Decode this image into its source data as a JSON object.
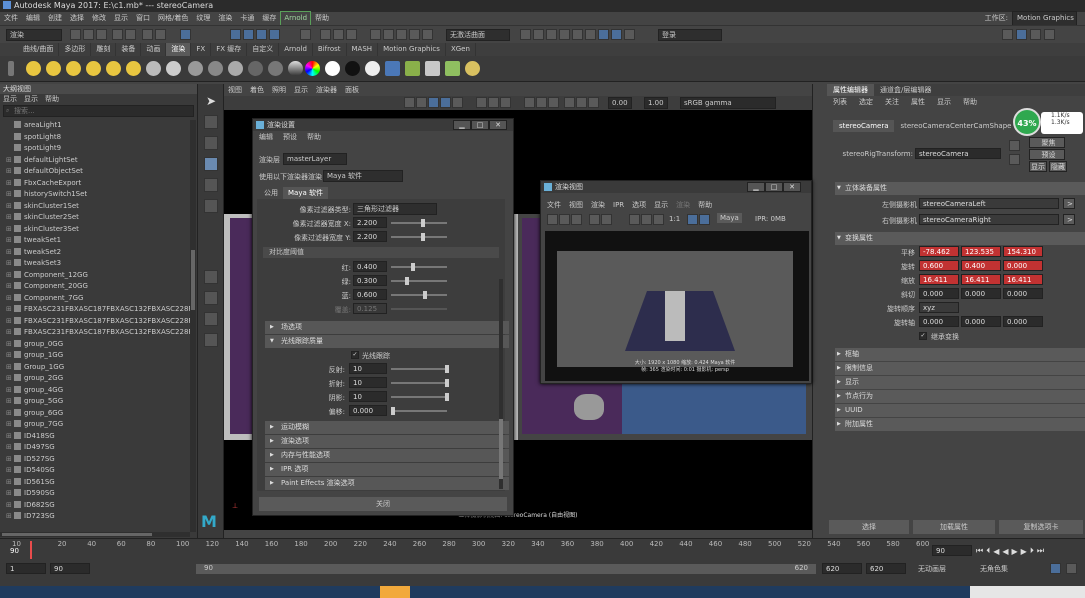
{
  "title": "Autodesk Maya 2017: E:\\c1.mb*   ---   stereoCamera",
  "menubar": {
    "items": [
      "文件",
      "编辑",
      "创建",
      "选择",
      "修改",
      "显示",
      "窗口",
      "网格/着色",
      "纹理",
      "渲染",
      "卡通",
      "缓存"
    ],
    "arnold": "Arnold",
    "help": "帮助",
    "workspace_label": "工作区:",
    "workspace_value": "Motion Graphics"
  },
  "statusline": {
    "mode": "渲染",
    "render_field": "无激活曲面",
    "login": "登录"
  },
  "shelf_tabs": [
    "曲线/曲面",
    "多边形",
    "雕刻",
    "装备",
    "动画",
    "渲染",
    "FX",
    "FX 缓存",
    "自定义",
    "Arnold",
    "Bifrost",
    "MASH",
    "Motion Graphics",
    "XGen"
  ],
  "active_shelf": "渲染",
  "outliner": {
    "title": "大纲视图",
    "menu": [
      "显示",
      "显示",
      "帮助"
    ],
    "search_placeholder": "搜索...",
    "items": [
      "areaLight1",
      "spotLight8",
      "spotLight9",
      "defaultLightSet",
      "defaultObjectSet",
      "FbxCacheExport",
      "historySwitch1Set",
      "skinCluster1Set",
      "skinCluster2Set",
      "skinCluster3Set",
      "tweakSet1",
      "tweakSet2",
      "tweakSet3",
      "Component_12GG",
      "Component_20GG",
      "Component_7GG",
      "FBXASC231FBXASC187FBXASC132FBXASC228FE",
      "FBXASC231FBXASC187FBXASC132FBXASC228FE",
      "FBXASC231FBXASC187FBXASC132FBXASC228FE",
      "group_0GG",
      "group_1GG",
      "Group_1GG",
      "group_2GG",
      "group_4GG",
      "group_5GG",
      "group_6GG",
      "group_7GG",
      "ID418SG",
      "ID497SG",
      "ID527SG",
      "ID540SG",
      "ID561SG",
      "ID590SG",
      "ID682SG",
      "ID723SG"
    ]
  },
  "viewport": {
    "menu": [
      "视图",
      "着色",
      "照明",
      "显示",
      "渲染器",
      "面板"
    ],
    "value1": "0.00",
    "value2": "1.00",
    "colorspace": "sRGB gamma",
    "caption": "立体摄影机视图: stereoCamera (自由视图)"
  },
  "render_settings": {
    "title": "渲染设置",
    "menu": [
      "编辑",
      "预设",
      "帮助"
    ],
    "layer_label": "渲染层",
    "layer_value": "masterLayer",
    "renderer_label": "使用以下渲染器渲染",
    "renderer_value": "Maya 软件",
    "tabs": [
      "公用",
      "Maya 软件"
    ],
    "filter_type_label": "像素过滤器类型:",
    "filter_type_value": "三角形过滤器",
    "filter_x_label": "像素过滤器宽度 X:",
    "filter_x_value": "2.200",
    "filter_y_label": "像素过滤器宽度 Y:",
    "filter_y_value": "2.200",
    "contrast_section": "对比度阈值",
    "red_label": "红:",
    "red_value": "0.400",
    "green_label": "绿:",
    "green_value": "0.300",
    "blue_label": "蓝:",
    "blue_value": "0.600",
    "alpha_label": "覆盖:",
    "alpha_value": "0.125",
    "sec_fields": "场选项",
    "sec_raytrace": "光线跟踪质量",
    "raytrace_check": "光线跟踪",
    "reflect_label": "反射:",
    "reflect_value": "10",
    "refract_label": "折射:",
    "refract_value": "10",
    "shadow_label": "阴影:",
    "shadow_value": "10",
    "bias_label": "偏移:",
    "bias_value": "0.000",
    "sections": [
      "运动模糊",
      "渲染选项",
      "内存与性能选项",
      "IPR 选项",
      "Paint Effects 渲染选项"
    ],
    "close": "关闭"
  },
  "render_view": {
    "title": "渲染视图",
    "menu": [
      "文件",
      "视图",
      "渲染",
      "IPR",
      "选项",
      "显示",
      "渲染",
      "帮助"
    ],
    "ratio": "1:1",
    "renderer": "Maya",
    "ipr": "IPR: 0MB",
    "info1": "大小: 1920 x 1080  缩放: 0.424   Maya 软件",
    "info2": "帧: 365   渲染时间: 0:01   摄影机: persp"
  },
  "attr": {
    "tabs": [
      "属性编辑器",
      "通道盒/层编辑器"
    ],
    "menu": [
      "列表",
      "选定",
      "关注",
      "属性",
      "显示",
      "帮助"
    ],
    "tab1": "stereoCamera",
    "tab2": "stereoCameraCenterCamShape",
    "transform_label": "stereoRigTransform:",
    "transform_value": "stereoCamera",
    "btn_focus": "聚焦",
    "btn_preset": "预设",
    "btn_show": "显示",
    "btn_hide": "隐藏",
    "stereo_section": "立体装备属性",
    "left_cam_label": "左侧摄影机",
    "left_cam_value": "stereoCameraLeft",
    "right_cam_label": "右侧摄影机",
    "right_cam_value": "stereoCameraRight",
    "transform_section": "变换属性",
    "translate_label": "平移",
    "translate": [
      "-78.462",
      "123.535",
      "154.310"
    ],
    "rotate_label": "旋转",
    "rotate": [
      "0.600",
      "0.400",
      "0.000"
    ],
    "scale_label": "缩放",
    "scale": [
      "16.411",
      "16.411",
      "16.411"
    ],
    "shear_label": "斜切",
    "shear": [
      "0.000",
      "0.000",
      "0.000"
    ],
    "rot_order_label": "旋转顺序",
    "rot_order_value": "xyz",
    "rot_axis_label": "旋转轴",
    "rot_axis": [
      "0.000",
      "0.000",
      "0.000"
    ],
    "inherit_label": "继承变换",
    "collapsed": [
      "枢轴",
      "限制信息",
      "显示",
      "节点行为",
      "UUID",
      "附加属性"
    ],
    "bottom_buttons": [
      "选择",
      "加载属性",
      "复制选项卡"
    ],
    "cpu_percent": "43%",
    "net_up": "1.1K/s",
    "net_down": "1.3K/s"
  },
  "timeline": {
    "ticks": [
      "10",
      "20",
      "40",
      "60",
      "80",
      "100",
      "120",
      "140",
      "160",
      "180",
      "200",
      "220",
      "240",
      "260",
      "280",
      "300",
      "320",
      "340",
      "360",
      "380",
      "400",
      "420",
      "440",
      "460",
      "480",
      "500",
      "520",
      "540",
      "560",
      "580",
      "600"
    ],
    "current_frame": "90",
    "frame_field": "90",
    "range_start": "1",
    "range_inner_start": "90",
    "range_inner_end": "620",
    "range_end1": "620",
    "range_end2": "620",
    "anim_layer": "无动画层",
    "char_set": "无角色集"
  }
}
